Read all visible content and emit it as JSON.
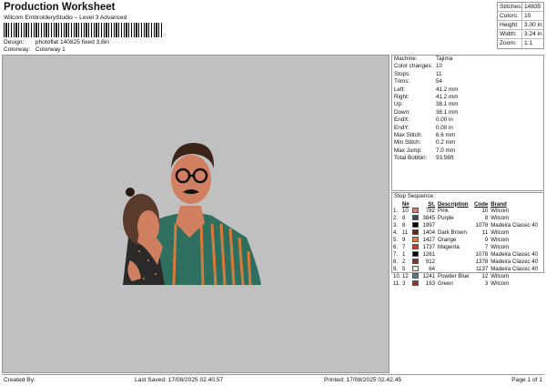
{
  "header": {
    "title": "Production Worksheet",
    "subtitle": "Wilcom EmbroideryStudio – Level 3 Advanced",
    "barcode_mark": ",",
    "design_label": "Design:",
    "design_value": "photoflat 140825 fixed 3,8in",
    "colorway_label": "Colorway:",
    "colorway_value": "Colorway 1"
  },
  "stats": [
    {
      "label": "Stitches:",
      "value": "14835"
    },
    {
      "label": "Colors:",
      "value": "10"
    },
    {
      "label": "Height:",
      "value": "3.00 in"
    },
    {
      "label": "Width:",
      "value": "3.24 in"
    },
    {
      "label": "Zoom:",
      "value": "1:1"
    }
  ],
  "machine_info": [
    {
      "label": "Machine:",
      "value": "Tajima"
    },
    {
      "label": "Color changes:",
      "value": "10"
    },
    {
      "label": "Stops:",
      "value": "11"
    },
    {
      "label": "Trims:",
      "value": "54"
    },
    {
      "label": "Left:",
      "value": "41.2 mm"
    },
    {
      "label": "Right:",
      "value": "41.2 mm"
    },
    {
      "label": "Up:",
      "value": "38.1 mm"
    },
    {
      "label": "Down:",
      "value": "38.1 mm"
    },
    {
      "label": "EndX:",
      "value": "0.00 in"
    },
    {
      "label": "EndY:",
      "value": "0.00 in"
    },
    {
      "label": "Max Stitch:",
      "value": "6.6 mm"
    },
    {
      "label": "Min Stitch:",
      "value": "0.2 mm"
    },
    {
      "label": "Max Jump:",
      "value": "7.0 mm"
    },
    {
      "label": "Total Bobbin:",
      "value": "93.56ft"
    }
  ],
  "stop_sequence": {
    "title": "Stop Sequence:",
    "headers": {
      "n": "N#",
      "st": "St.",
      "desc": "Description",
      "code": "Code",
      "brand": "Brand"
    },
    "rows": [
      {
        "idx": "1.",
        "n": "10",
        "color": "#d08078",
        "st": "782",
        "desc": "Pink",
        "code": "10",
        "brand": "Wilcom"
      },
      {
        "idx": "2.",
        "n": "8",
        "color": "#3a4a5a",
        "st": "3845",
        "desc": "Purple",
        "code": "8",
        "brand": "Wilcom"
      },
      {
        "idx": "3.",
        "n": "8",
        "color": "#000000",
        "st": "1997",
        "desc": "",
        "code": "1078",
        "brand": "Madeira Classic 40"
      },
      {
        "idx": "4.",
        "n": "11",
        "color": "#5a2a1a",
        "st": "1404",
        "desc": "Dark Brown",
        "code": "11",
        "brand": "Wilcom"
      },
      {
        "idx": "5.",
        "n": "9",
        "color": "#e07a4a",
        "st": "1427",
        "desc": "Orange",
        "code": "9",
        "brand": "Wilcom"
      },
      {
        "idx": "6.",
        "n": "7",
        "color": "#c0402a",
        "st": "1737",
        "desc": "Magenta",
        "code": "7",
        "brand": "Wilcom"
      },
      {
        "idx": "7.",
        "n": "1",
        "color": "#000000",
        "st": "1261",
        "desc": "",
        "code": "1078",
        "brand": "Madeira Classic 40"
      },
      {
        "idx": "8.",
        "n": "2",
        "color": "#7a3a2a",
        "st": "912",
        "desc": "",
        "code": "1378",
        "brand": "Madeira Classic 40"
      },
      {
        "idx": "9.",
        "n": "5",
        "color": "#f4ecd8",
        "st": "64",
        "desc": "",
        "code": "1137",
        "brand": "Madeira Classic 40"
      },
      {
        "idx": "10.",
        "n": "12",
        "color": "#5a7a8a",
        "st": "1241",
        "desc": "Powder Blue",
        "code": "12",
        "brand": "Wilcom"
      },
      {
        "idx": "11.",
        "n": "3",
        "color": "#8a3a2a",
        "st": "163",
        "desc": "Green",
        "code": "3",
        "brand": "Wilcom"
      }
    ]
  },
  "footer": {
    "created_by": "Created By:",
    "last_saved": "Last Saved: 17/08/2025 02.40.57",
    "printed": "Printed: 17/08/2025 02.42.45",
    "page": "Page 1 of 1"
  },
  "colors": {
    "canvas_bg": "#c0c0c0",
    "shirt_green": "#2f6f5f",
    "stripe_orange": "#d87a3a",
    "dress_dark": "#2a2a2a",
    "skin": "#d08060",
    "hair": "#3a2418"
  }
}
